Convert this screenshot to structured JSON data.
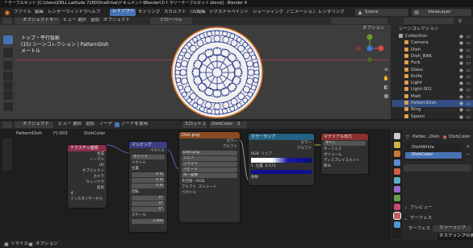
{
  "window": {
    "title": "* テーブルセット [C:\\Users\\DELL Latitude 7280\\OneDrive\\ドキュメント\\Blender\\カトラリーテーブルセット.blend] - Blender 4.3.2"
  },
  "menu": {
    "items": [
      "ファイル",
      "編集",
      "レンダー",
      "ウィンドウ",
      "ヘルプ"
    ]
  },
  "workspaces": {
    "tabs": [
      "レイアウト",
      "モデリング",
      "スカルプト",
      "UV編集",
      "テクスチャペイント",
      "シェーディング",
      "アニメーション",
      "レンダリング"
    ],
    "active_index": 0
  },
  "top_right": {
    "scene_label": "Scene",
    "view_layer_label": "ViewLayer"
  },
  "viewport": {
    "mode": "オブジェクトモード",
    "menus": [
      "ビュー",
      "選択",
      "追加",
      "オブジェクト"
    ],
    "transform": "グローバル",
    "options_label": "オプション",
    "info_line1": "トップ・平行投影",
    "info_line2": "(15) シーンコレクション | PatternDish",
    "info_line3": "メートル"
  },
  "outliner": {
    "title": "シーンコレクション",
    "items": [
      {
        "name": "Collection",
        "indent": 0,
        "selected": false,
        "color": "#aaaaaa"
      },
      {
        "name": "Camera",
        "indent": 1,
        "selected": false,
        "color": "#e39f4c"
      },
      {
        "name": "Dish",
        "indent": 1,
        "selected": false,
        "color": "#e39f4c"
      },
      {
        "name": "Dish_BAK",
        "indent": 1,
        "selected": false,
        "color": "#e39f4c"
      },
      {
        "name": "Fork",
        "indent": 1,
        "selected": false,
        "color": "#e39f4c"
      },
      {
        "name": "Glass",
        "indent": 1,
        "selected": false,
        "color": "#e39f4c"
      },
      {
        "name": "Knife",
        "indent": 1,
        "selected": false,
        "color": "#e39f4c"
      },
      {
        "name": "Light",
        "indent": 1,
        "selected": false,
        "color": "#e39f4c"
      },
      {
        "name": "Light.001",
        "indent": 1,
        "selected": false,
        "color": "#e39f4c"
      },
      {
        "name": "Matt",
        "indent": 1,
        "selected": false,
        "color": "#e39f4c"
      },
      {
        "name": "PatternDish",
        "indent": 1,
        "selected": true,
        "color": "#e39f4c"
      },
      {
        "name": "Ring",
        "indent": 1,
        "selected": false,
        "color": "#e39f4c"
      },
      {
        "name": "Spoon",
        "indent": 1,
        "selected": false,
        "color": "#e39f4c"
      }
    ]
  },
  "node_editor": {
    "mode": "オブジェクト",
    "menus": [
      "ビュー",
      "選択",
      "追加",
      "ノード"
    ],
    "use_nodes_label": "ノードを使用",
    "slot_label": "スロット 2",
    "material_name": "DishColor",
    "user_count": "2",
    "breadcrumb": [
      "PatternDish",
      "円.003",
      "DishColor"
    ],
    "nodes": {
      "texcoord": {
        "title": "テクスチャ座標",
        "outputs": [
          "生成",
          "ノーマル",
          "UV",
          "オブジェクト",
          "カメラ",
          "ウィンドウ",
          "反射"
        ],
        "footer1": "オ...",
        "footer2": "インスタンサーから"
      },
      "mapping": {
        "title": "マッピング",
        "output": "ベクトル",
        "type_label": "タイプ",
        "type_value": "ポイント",
        "vector_label": "ベクトル",
        "location_label": "位置",
        "rotation_label": "回転",
        "scale_label": "スケール",
        "loc": [
          "0 m",
          "0 m",
          "0 m"
        ],
        "rot": [
          "0°",
          "0°",
          "0°"
        ],
        "scale": [
          "1.000",
          "1.000",
          "1.000"
        ]
      },
      "image": {
        "title": "Dish.png",
        "out_color": "カラー",
        "out_alpha": "アルファ",
        "image_name": "Dish.png",
        "interp": "リニア",
        "proj": "フラット",
        "ext": "リピート",
        "source": "単一画像",
        "colorspace_label": "色空間",
        "colorspace": "sRGB",
        "alpha_label": "アルファ",
        "alpha": "ストレート",
        "vector": "ベクトル"
      },
      "ramp": {
        "title": "カラーランプ",
        "out_color": "カラー",
        "out_alpha": "アルファ",
        "mode": "RGB",
        "interp": "リニア",
        "stop_index": "1",
        "pos_label": "位置",
        "pos_value": "0.573",
        "fac": "係数"
      },
      "output": {
        "title": "マテリアル出力",
        "target": "すべて",
        "inputs": [
          "サーフェス",
          "ボリューム",
          "ディスプレイスメント",
          "厚み"
        ]
      }
    }
  },
  "props": {
    "object_name": "Patter...Dish",
    "material_name": "DishColor",
    "slots": [
      "DishWhite",
      "DishColor"
    ],
    "active_slot": 1,
    "preview_label": "プレビュー",
    "surface_section": "サーフェス",
    "surface_label": "サーフェス",
    "surface_value": "カラーランプ",
    "tooltip": "ダスクランプの表"
  },
  "statusbar": {
    "items": [
      "リサイズ",
      "オプション"
    ]
  }
}
